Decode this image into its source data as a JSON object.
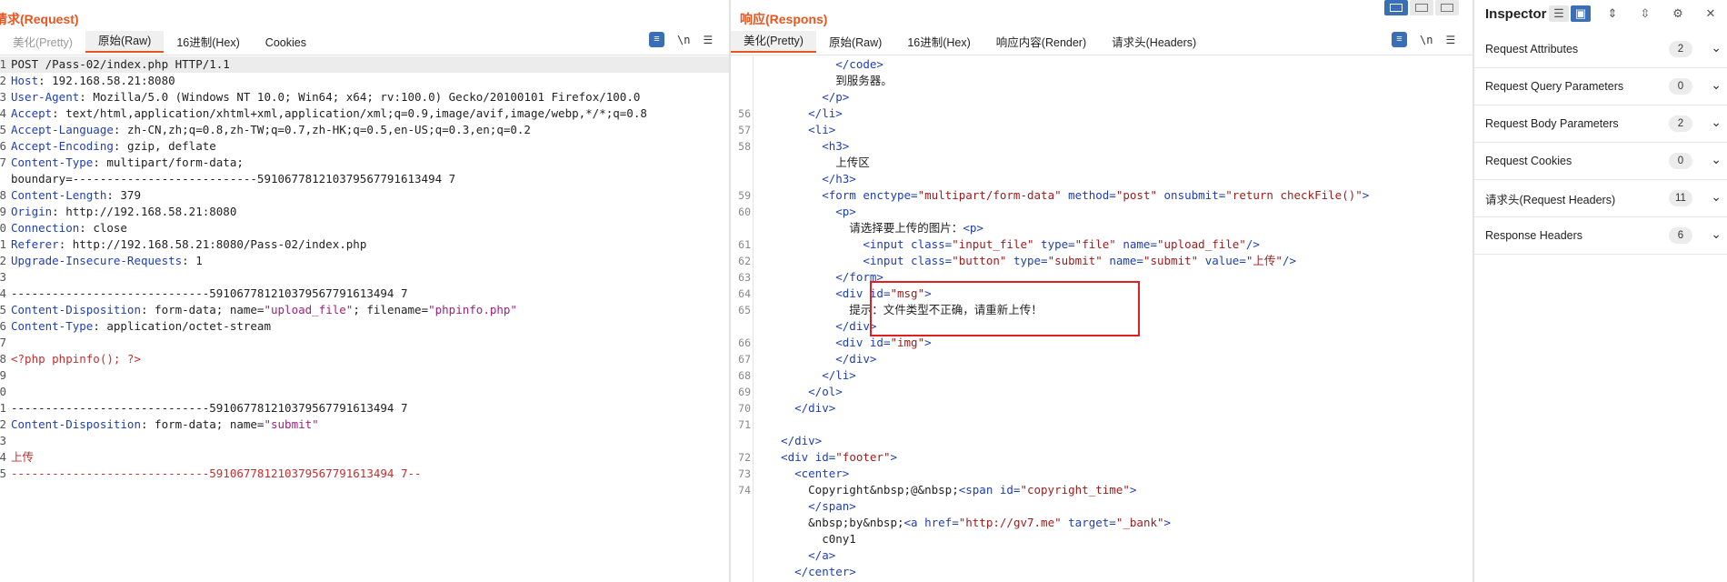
{
  "request": {
    "title": "请求(Request)",
    "tabs": [
      {
        "label": "美化(Pretty)",
        "dim": true
      },
      {
        "label": "原始(Raw)",
        "active": true
      },
      {
        "label": "16进制(Hex)"
      },
      {
        "label": "Cookies"
      }
    ],
    "tool_newline": "\\n",
    "lines": [
      {
        "n": "1",
        "t": [
          [
            "POST /Pass-02/index.php HTTP/1.1",
            ""
          ]
        ],
        "hl": true
      },
      {
        "n": "2",
        "t": [
          [
            "Host",
            "k"
          ],
          [
            ": 192.168.58.21:8080",
            ""
          ]
        ]
      },
      {
        "n": "3",
        "t": [
          [
            "User-Agent",
            "k"
          ],
          [
            ": Mozilla/5.0 (Windows NT 10.0; Win64; x64; rv:100.0) Gecko/20100101 Firefox/100.0",
            ""
          ]
        ]
      },
      {
        "n": "4",
        "t": [
          [
            "Accept",
            "k"
          ],
          [
            ": text/html,application/xhtml+xml,application/xml;q=0.9,image/avif,image/webp,*/*;q=0.8",
            ""
          ]
        ]
      },
      {
        "n": "5",
        "t": [
          [
            "Accept-Language",
            "k"
          ],
          [
            ": zh-CN,zh;q=0.8,zh-TW;q=0.7,zh-HK;q=0.5,en-US;q=0.3,en;q=0.2",
            ""
          ]
        ]
      },
      {
        "n": "6",
        "t": [
          [
            "Accept-Encoding",
            "k"
          ],
          [
            ": gzip, deflate",
            ""
          ]
        ]
      },
      {
        "n": "7",
        "t": [
          [
            "Content-Type",
            "k"
          ],
          [
            ": multipart/form-data;",
            ""
          ]
        ]
      },
      {
        "n": "",
        "t": [
          [
            "boundary=---------------------------591067781210379567791613494 7",
            ""
          ]
        ]
      },
      {
        "n": "8",
        "t": [
          [
            "Content-Length",
            "k"
          ],
          [
            ": 379",
            ""
          ]
        ]
      },
      {
        "n": "9",
        "t": [
          [
            "Origin",
            "k"
          ],
          [
            ": http://192.168.58.21:8080",
            ""
          ]
        ]
      },
      {
        "n": "0",
        "t": [
          [
            "Connection",
            "k"
          ],
          [
            ": close",
            ""
          ]
        ]
      },
      {
        "n": "1",
        "t": [
          [
            "Referer",
            "k"
          ],
          [
            ": http://192.168.58.21:8080/Pass-02/index.php",
            ""
          ]
        ]
      },
      {
        "n": "2",
        "t": [
          [
            "Upgrade-Insecure-Requests",
            "k"
          ],
          [
            ": 1",
            ""
          ]
        ]
      },
      {
        "n": "3",
        "t": []
      },
      {
        "n": "4",
        "t": [
          [
            "-----------------------------591067781210379567791613494 7",
            ""
          ]
        ]
      },
      {
        "n": "5",
        "t": [
          [
            "Content-Disposition",
            "k"
          ],
          [
            ": form-data; name=",
            ""
          ],
          [
            "\"upload_file\"",
            "v"
          ],
          [
            "; filename=",
            ""
          ],
          [
            "\"phpinfo.php\"",
            "v"
          ]
        ]
      },
      {
        "n": "6",
        "t": [
          [
            "Content-Type",
            "k"
          ],
          [
            ": application/octet-stream",
            ""
          ]
        ]
      },
      {
        "n": "7",
        "t": []
      },
      {
        "n": "8",
        "t": [
          [
            "<?php phpinfo(); ?>",
            "r"
          ]
        ]
      },
      {
        "n": "9",
        "t": []
      },
      {
        "n": "0",
        "t": []
      },
      {
        "n": "1",
        "t": [
          [
            "-----------------------------591067781210379567791613494 7",
            ""
          ]
        ]
      },
      {
        "n": "2",
        "t": [
          [
            "Content-Disposition",
            "k"
          ],
          [
            ": form-data; name=",
            ""
          ],
          [
            "\"submit\"",
            "v"
          ]
        ]
      },
      {
        "n": "3",
        "t": []
      },
      {
        "n": "4",
        "t": [
          [
            "上传",
            "r"
          ]
        ]
      },
      {
        "n": "5",
        "t": [
          [
            "-----------------------------591067781210379567791613494 7--",
            "r"
          ]
        ]
      }
    ]
  },
  "response": {
    "title": "响应(Respons)",
    "tabs": [
      {
        "label": "美化(Pretty)",
        "active": true
      },
      {
        "label": "原始(Raw)"
      },
      {
        "label": "16进制(Hex)"
      },
      {
        "label": "响应内容(Render)"
      },
      {
        "label": "请求头(Headers)"
      }
    ],
    "tool_newline": "\\n",
    "lines": [
      {
        "n": "",
        "t": [
          [
            "          </code>",
            "tg"
          ]
        ]
      },
      {
        "n": "",
        "t": [
          [
            "          到服务器。",
            ""
          ]
        ]
      },
      {
        "n": "",
        "t": [
          [
            "        </p>",
            "tg"
          ]
        ]
      },
      {
        "n": "56",
        "t": [
          [
            "      </li>",
            "tg"
          ]
        ]
      },
      {
        "n": "57",
        "t": [
          [
            "      <li>",
            "tg"
          ]
        ]
      },
      {
        "n": "58",
        "t": [
          [
            "        <h3>",
            "tg"
          ]
        ]
      },
      {
        "n": "",
        "t": [
          [
            "          上传区",
            ""
          ]
        ]
      },
      {
        "n": "",
        "t": [
          [
            "        </h3>",
            "tg"
          ]
        ]
      },
      {
        "n": "59",
        "t": [
          [
            "        <form ",
            "tg"
          ],
          [
            "enctype=",
            "an"
          ],
          [
            "\"multipart/form-data\"",
            "av"
          ],
          [
            " method=",
            "an"
          ],
          [
            "\"post\"",
            "av"
          ],
          [
            " onsubmit=",
            "an"
          ],
          [
            "\"return checkFile()\"",
            "av"
          ],
          [
            ">",
            "tg"
          ]
        ]
      },
      {
        "n": "60",
        "t": [
          [
            "          <p>",
            "tg"
          ]
        ]
      },
      {
        "n": "",
        "t": [
          [
            "            请选择要上传的图片：",
            ""
          ],
          [
            "<p>",
            "tg"
          ]
        ]
      },
      {
        "n": "61",
        "t": [
          [
            "              <input ",
            "tg"
          ],
          [
            "class=",
            "an"
          ],
          [
            "\"input_file\"",
            "av"
          ],
          [
            " type=",
            "an"
          ],
          [
            "\"file\"",
            "av"
          ],
          [
            " name=",
            "an"
          ],
          [
            "\"upload_file\"",
            "av"
          ],
          [
            "/>",
            "tg"
          ]
        ]
      },
      {
        "n": "62",
        "t": [
          [
            "              <input ",
            "tg"
          ],
          [
            "class=",
            "an"
          ],
          [
            "\"button\"",
            "av"
          ],
          [
            " type=",
            "an"
          ],
          [
            "\"submit\"",
            "av"
          ],
          [
            " name=",
            "an"
          ],
          [
            "\"submit\"",
            "av"
          ],
          [
            " value=",
            "an"
          ],
          [
            "\"上传\"",
            "av"
          ],
          [
            "/>",
            "tg"
          ]
        ]
      },
      {
        "n": "63",
        "t": [
          [
            "          </form>",
            "tg"
          ]
        ]
      },
      {
        "n": "64",
        "t": [
          [
            "          <div ",
            "tg"
          ],
          [
            "id=",
            "an"
          ],
          [
            "\"msg\"",
            "av"
          ],
          [
            ">",
            "tg"
          ]
        ]
      },
      {
        "n": "65",
        "t": [
          [
            "            提示：文件类型不正确，请重新上传！",
            ""
          ]
        ]
      },
      {
        "n": "",
        "t": [
          [
            "          </div>",
            "tg"
          ]
        ]
      },
      {
        "n": "66",
        "t": [
          [
            "          <div ",
            "tg"
          ],
          [
            "id=",
            "an"
          ],
          [
            "\"img\"",
            "av"
          ],
          [
            ">",
            "tg"
          ]
        ]
      },
      {
        "n": "67",
        "t": [
          [
            "          </div>",
            "tg"
          ]
        ]
      },
      {
        "n": "68",
        "t": [
          [
            "        </li>",
            "tg"
          ]
        ]
      },
      {
        "n": "69",
        "t": [
          [
            "      </ol>",
            "tg"
          ]
        ]
      },
      {
        "n": "70",
        "t": [
          [
            "    </div>",
            "tg"
          ]
        ]
      },
      {
        "n": "71",
        "t": []
      },
      {
        "n": "",
        "t": [
          [
            "  </div>",
            "tg"
          ]
        ]
      },
      {
        "n": "72",
        "t": [
          [
            "  <div ",
            "tg"
          ],
          [
            "id=",
            "an"
          ],
          [
            "\"footer\"",
            "av"
          ],
          [
            ">",
            "tg"
          ]
        ]
      },
      {
        "n": "73",
        "t": [
          [
            "    <center>",
            "tg"
          ]
        ]
      },
      {
        "n": "74",
        "t": [
          [
            "      Copyright&nbsp;@&nbsp;",
            ""
          ],
          [
            "<span ",
            "tg"
          ],
          [
            "id=",
            "an"
          ],
          [
            "\"copyright_time\"",
            "av"
          ],
          [
            ">",
            "tg"
          ]
        ]
      },
      {
        "n": "",
        "t": [
          [
            "      </span>",
            "tg"
          ]
        ]
      },
      {
        "n": "",
        "t": [
          [
            "      &nbsp;by&nbsp;",
            ""
          ],
          [
            "<a ",
            "tg"
          ],
          [
            "href=",
            "an"
          ],
          [
            "\"http://gv7.me\"",
            "av"
          ],
          [
            " target=",
            "an"
          ],
          [
            "\"_bank\"",
            "av"
          ],
          [
            ">",
            "tg"
          ]
        ]
      },
      {
        "n": "",
        "t": [
          [
            "        c0ny1",
            ""
          ]
        ]
      },
      {
        "n": "",
        "t": [
          [
            "      </a>",
            "tg"
          ]
        ]
      },
      {
        "n": "",
        "t": [
          [
            "    </center>",
            "tg"
          ]
        ]
      }
    ]
  },
  "inspector": {
    "title": "Inspector",
    "rows": [
      {
        "label": "Request Attributes",
        "count": "2"
      },
      {
        "label": "Request Query Parameters",
        "count": "0"
      },
      {
        "label": "Request Body Parameters",
        "count": "2"
      },
      {
        "label": "Request Cookies",
        "count": "0"
      },
      {
        "label": "请求头(Request Headers)",
        "count": "11"
      },
      {
        "label": "Response Headers",
        "count": "6"
      }
    ]
  },
  "colors": {
    "accent": "#e8561f",
    "highlight_box": "#e0201e",
    "button_blue": "#3a6fb5"
  }
}
